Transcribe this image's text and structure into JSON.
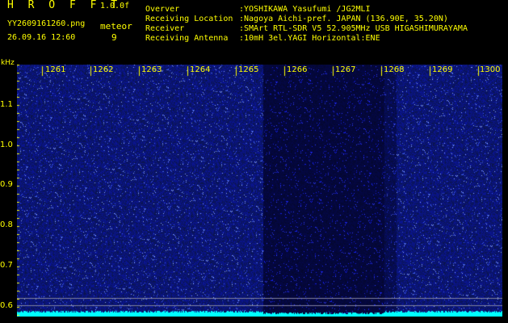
{
  "header": {
    "app_title": "H R O F F T",
    "app_version": "1.0.0f",
    "filename": "YY2609161260.png",
    "datetime": "26.09.16 12:60",
    "meteor_label": "meteor",
    "meteor_count": "9"
  },
  "info": [
    {
      "key": "Overver",
      "value": ":YOSHIKAWA Yasufumi /JG2MLI"
    },
    {
      "key": "Receiving Location",
      "value": ":Nagoya Aichi-pref. JAPAN (136.90E, 35.20N)"
    },
    {
      "key": "Receiver",
      "value": ":SMArt RTL-SDR V5 52.905MHz USB HIGASHIMURAYAMA"
    },
    {
      "key": "Receiving Antenna",
      "value": ":10mH 3el.YAGI Horizontal:ENE"
    }
  ],
  "axis": {
    "y_unit": "kHz",
    "y_ticks": [
      "1.1",
      "1.0",
      "0.9",
      "0.8",
      "0.7",
      "0.6"
    ],
    "x_ticks": [
      "1261",
      "1262",
      "1263",
      "1264",
      "1265",
      "1266",
      "1267",
      "1268",
      "1269",
      "1300"
    ]
  },
  "colors": {
    "text": "#ffff00",
    "background": "#000000",
    "spectrogram_base": "#1a2a8c",
    "baseline": "#00ffff",
    "gridline": "#8080a0"
  }
}
